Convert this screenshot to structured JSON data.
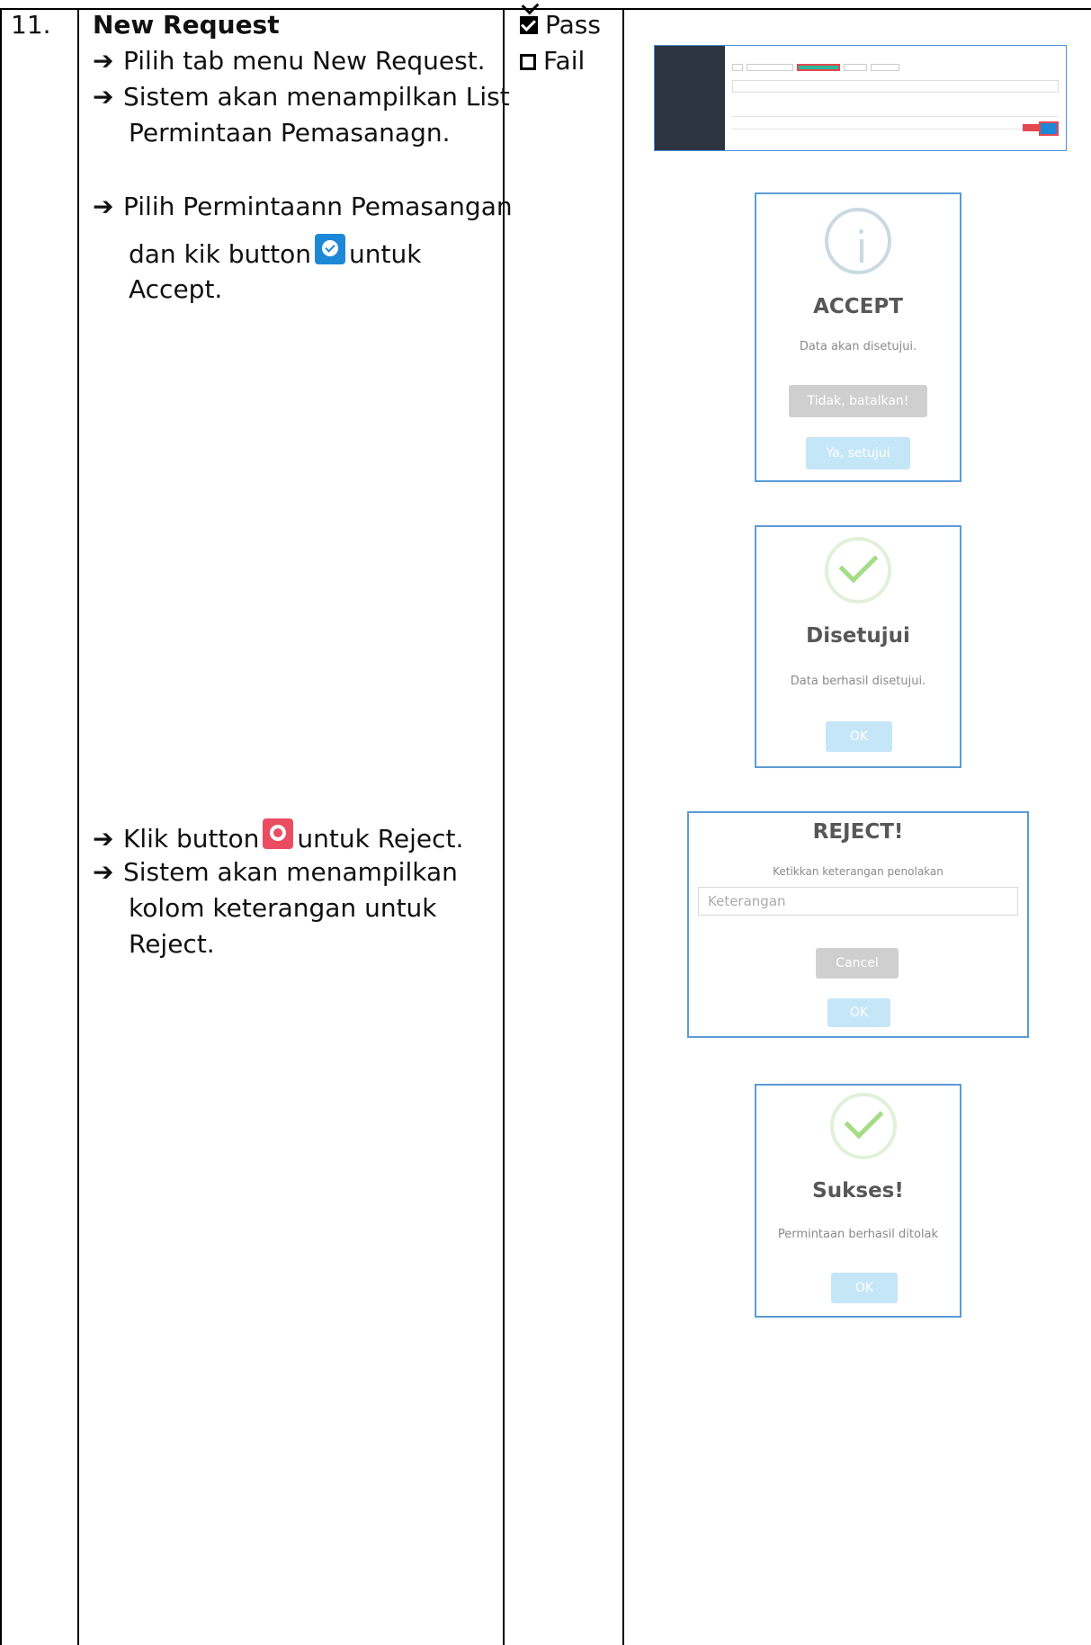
{
  "row": {
    "number": "11.",
    "heading": "New Request",
    "steps": {
      "s1": "Pilih tab menu New Request.",
      "s2a": "Sistem akan menampilkan List",
      "s2b": "Permintaan Pemasanagn.",
      "s3a": "Pilih Permintaann Pemasangan",
      "s3b_pre": "dan kik button",
      "s3b_post": "untuk",
      "s3c": "Accept.",
      "s4_pre": "Klik button",
      "s4_post": "untuk Reject.",
      "s5a": "Sistem akan menampilkan",
      "s5b": "kolom keterangan untuk",
      "s5c": "Reject."
    },
    "result": {
      "pass": "Pass",
      "fail": "Fail",
      "pass_checked": true
    }
  },
  "dialogs": {
    "accept": {
      "title": "ACCEPT",
      "message": "Data akan disetujui.",
      "cancel": "Tidak, batalkan!",
      "confirm": "Ya, setujui"
    },
    "approved": {
      "title": "Disetujui",
      "message": "Data berhasil disetujui.",
      "ok": "OK"
    },
    "reject": {
      "title": "REJECT!",
      "message": "Ketikkan keterangan penolakan",
      "input_placeholder": "Keterangan",
      "cancel": "Cancel",
      "ok": "OK"
    },
    "success": {
      "title": "Sukses!",
      "message": "Permintaan berhasil ditolak",
      "ok": "OK"
    }
  },
  "colors": {
    "accept_button": "#1e88d8",
    "reject_button": "#ea4d61",
    "dialog_border": "#5b9bd5"
  },
  "icons": {
    "accept": "check-circle-icon",
    "reject": "stop-circle-icon",
    "info": "info-icon",
    "success": "checkmark-icon"
  }
}
